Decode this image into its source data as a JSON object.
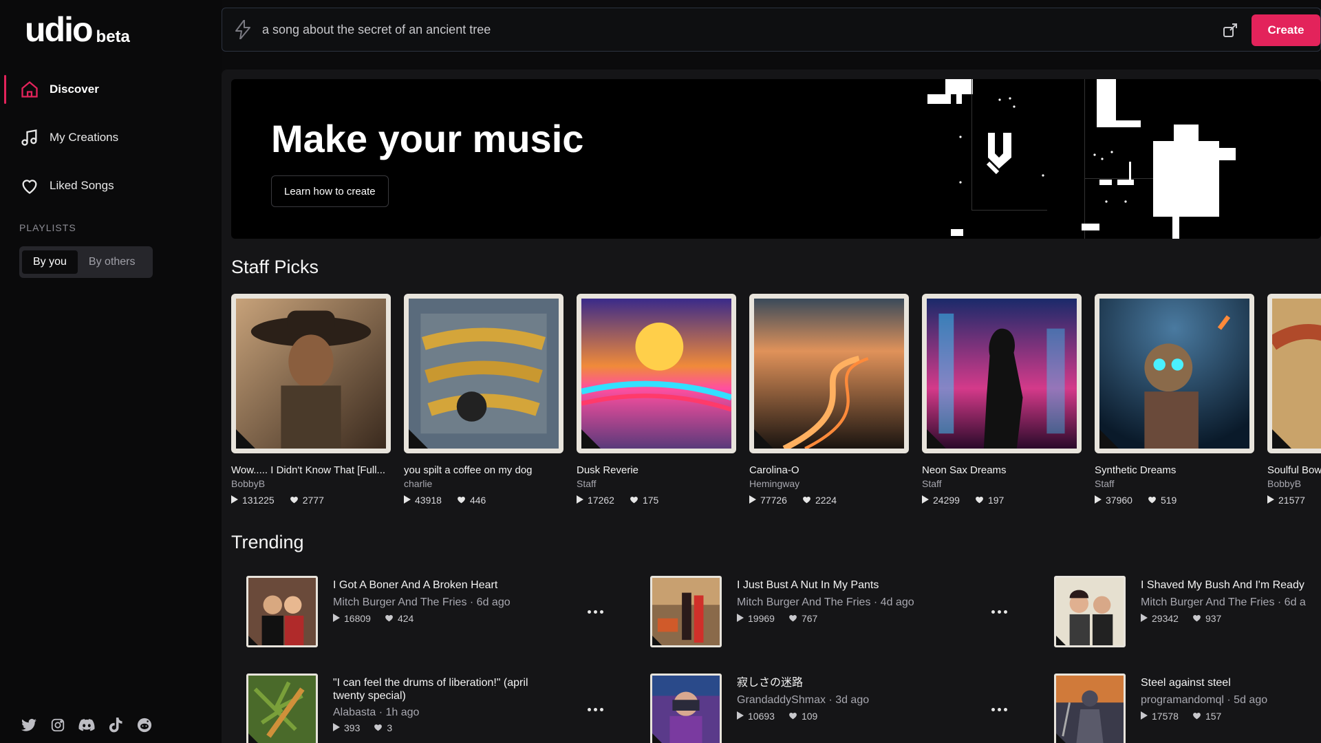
{
  "logo": {
    "main": "udio",
    "beta": "beta"
  },
  "nav": {
    "discover": "Discover",
    "my_creations": "My Creations",
    "liked_songs": "Liked Songs"
  },
  "playlists": {
    "heading": "PLAYLISTS",
    "by_you": "By you",
    "by_others": "By others"
  },
  "search": {
    "value": "a song about the secret of an ancient tree",
    "create_label": "Create"
  },
  "hero": {
    "title": "Make your music",
    "button": "Learn how to create"
  },
  "staff_picks": {
    "title": "Staff Picks",
    "items": [
      {
        "title": "Wow..... I Didn't Know That [Full...",
        "artist": "BobbyB",
        "plays": "131225",
        "likes": "2777"
      },
      {
        "title": "you spilt a coffee on my dog",
        "artist": "charlie",
        "plays": "43918",
        "likes": "446"
      },
      {
        "title": "Dusk Reverie",
        "artist": "Staff",
        "plays": "17262",
        "likes": "175"
      },
      {
        "title": "Carolina-O",
        "artist": "Hemingway",
        "plays": "77726",
        "likes": "2224"
      },
      {
        "title": "Neon Sax Dreams",
        "artist": "Staff",
        "plays": "24299",
        "likes": "197"
      },
      {
        "title": "Synthetic Dreams",
        "artist": "Staff",
        "plays": "37960",
        "likes": "519"
      },
      {
        "title": "Soulful Bow",
        "artist": "BobbyB",
        "plays": "21577",
        "likes": ""
      }
    ]
  },
  "trending": {
    "title": "Trending",
    "items": [
      {
        "title": "I Got A Boner And A Broken Heart",
        "artist": "Mitch Burger And The Fries",
        "age": "6d ago",
        "plays": "16809",
        "likes": "424"
      },
      {
        "title": "I Just Bust A Nut In My Pants",
        "artist": "Mitch Burger And The Fries",
        "age": "4d ago",
        "plays": "19969",
        "likes": "767"
      },
      {
        "title": "I Shaved My Bush And I'm Ready",
        "artist": "Mitch Burger And The Fries",
        "age": "6d a",
        "plays": "29342",
        "likes": "937"
      },
      {
        "title": "\"I can feel the drums of liberation!\" (april twenty special)",
        "artist": "Alabasta",
        "age": "1h ago",
        "plays": "393",
        "likes": "3"
      },
      {
        "title": "寂しさの迷路",
        "artist": "GrandaddyShmax",
        "age": "3d ago",
        "plays": "10693",
        "likes": "109"
      },
      {
        "title": "Steel against steel",
        "artist": "programandomql",
        "age": "5d ago",
        "plays": "17578",
        "likes": "157"
      }
    ]
  },
  "colors": {
    "accent": "#e3235b",
    "bg": "#0b0b0c",
    "panel": "#151517"
  },
  "icons": {
    "nav": [
      "home-icon",
      "music-note-icon",
      "heart-icon"
    ],
    "social": [
      "twitter-icon",
      "instagram-icon",
      "discord-icon",
      "tiktok-icon",
      "reddit-icon"
    ]
  }
}
